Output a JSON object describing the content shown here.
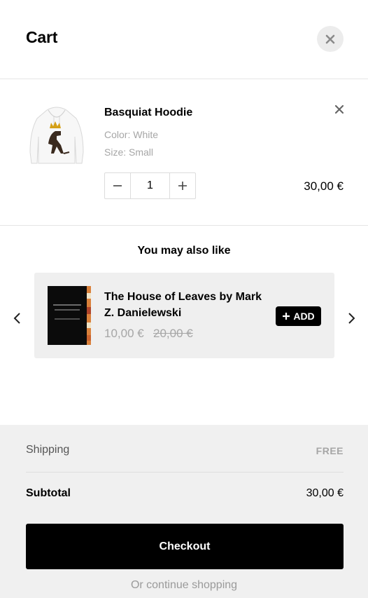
{
  "header": {
    "title": "Cart",
    "close_icon": "close-icon"
  },
  "line_item": {
    "name": "Basquiat Hoodie",
    "color": "Color: White",
    "size": "Size: Small",
    "quantity": "1",
    "price": "30,00 €",
    "remove_icon": "close-icon"
  },
  "upsell": {
    "title": "You may also like",
    "product": {
      "name": "The House of Leaves by Mark Z. Danielewski",
      "price": "10,00 €",
      "compare_price": "20,00 €",
      "add_label": "ADD"
    }
  },
  "summary": {
    "shipping_label": "Shipping",
    "shipping_value": "FREE",
    "subtotal_label": "Subtotal",
    "subtotal_value": "30,00 €",
    "checkout_label": "Checkout",
    "continue_label": "Or continue shopping"
  },
  "colors": {
    "accent": "#000000",
    "muted": "#a6a6a6",
    "footer_bg": "#f0f0f0",
    "card_bg": "#efefef"
  }
}
